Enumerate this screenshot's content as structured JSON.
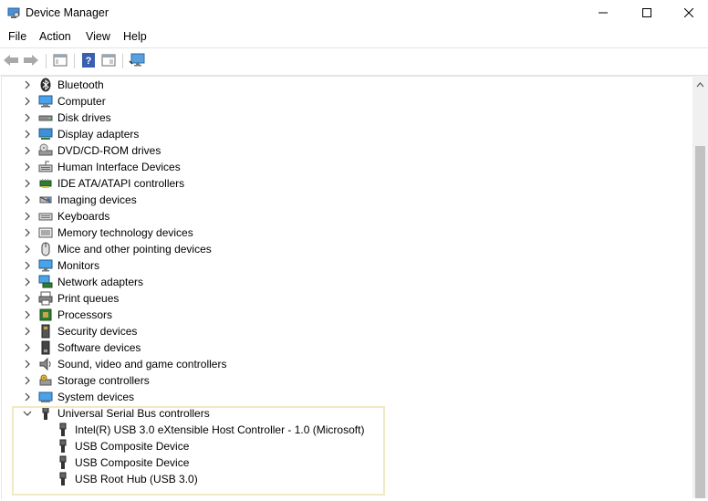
{
  "window": {
    "title": "Device Manager",
    "icons": {
      "app": "device-manager-icon",
      "minimize": "minimize-icon",
      "maximize": "maximize-icon",
      "close": "close-icon"
    }
  },
  "menu": {
    "items": [
      "File",
      "Action",
      "View",
      "Help"
    ]
  },
  "toolbar": {
    "buttons": [
      "back-arrow-icon",
      "forward-arrow-icon",
      "properties-window-icon",
      "help-icon",
      "show-hidden-icon",
      "monitor-scan-icon"
    ]
  },
  "tree": {
    "categories": [
      {
        "label": "Bluetooth",
        "icon": "bluetooth-icon",
        "expanded": false
      },
      {
        "label": "Computer",
        "icon": "computer-icon",
        "expanded": false
      },
      {
        "label": "Disk drives",
        "icon": "disk-drive-icon",
        "expanded": false
      },
      {
        "label": "Display adapters",
        "icon": "display-adapter-icon",
        "expanded": false
      },
      {
        "label": "DVD/CD-ROM drives",
        "icon": "dvd-drive-icon",
        "expanded": false
      },
      {
        "label": "Human Interface Devices",
        "icon": "hid-icon",
        "expanded": false
      },
      {
        "label": "IDE ATA/ATAPI controllers",
        "icon": "ide-controller-icon",
        "expanded": false
      },
      {
        "label": "Imaging devices",
        "icon": "imaging-device-icon",
        "expanded": false
      },
      {
        "label": "Keyboards",
        "icon": "keyboard-icon",
        "expanded": false
      },
      {
        "label": "Memory technology devices",
        "icon": "memory-device-icon",
        "expanded": false
      },
      {
        "label": "Mice and other pointing devices",
        "icon": "mouse-icon",
        "expanded": false
      },
      {
        "label": "Monitors",
        "icon": "monitor-icon",
        "expanded": false
      },
      {
        "label": "Network adapters",
        "icon": "network-adapter-icon",
        "expanded": false
      },
      {
        "label": "Print queues",
        "icon": "printer-icon",
        "expanded": false
      },
      {
        "label": "Processors",
        "icon": "processor-icon",
        "expanded": false
      },
      {
        "label": "Security devices",
        "icon": "security-device-icon",
        "expanded": false
      },
      {
        "label": "Software devices",
        "icon": "software-device-icon",
        "expanded": false
      },
      {
        "label": "Sound, video and game controllers",
        "icon": "sound-icon",
        "expanded": false
      },
      {
        "label": "Storage controllers",
        "icon": "storage-controller-icon",
        "expanded": false
      },
      {
        "label": "System devices",
        "icon": "system-device-icon",
        "expanded": false
      },
      {
        "label": "Universal Serial Bus controllers",
        "icon": "usb-icon",
        "expanded": true,
        "children": [
          {
            "label": "Intel(R) USB 3.0 eXtensible Host Controller - 1.0 (Microsoft)",
            "icon": "usb-icon"
          },
          {
            "label": "USB Composite Device",
            "icon": "usb-icon"
          },
          {
            "label": "USB Composite Device",
            "icon": "usb-icon"
          },
          {
            "label": "USB Root Hub (USB 3.0)",
            "icon": "usb-icon"
          }
        ]
      }
    ]
  },
  "colors": {
    "highlight_border": "#efe9c4",
    "scrollbar_thumb": "#c2c2c2"
  }
}
